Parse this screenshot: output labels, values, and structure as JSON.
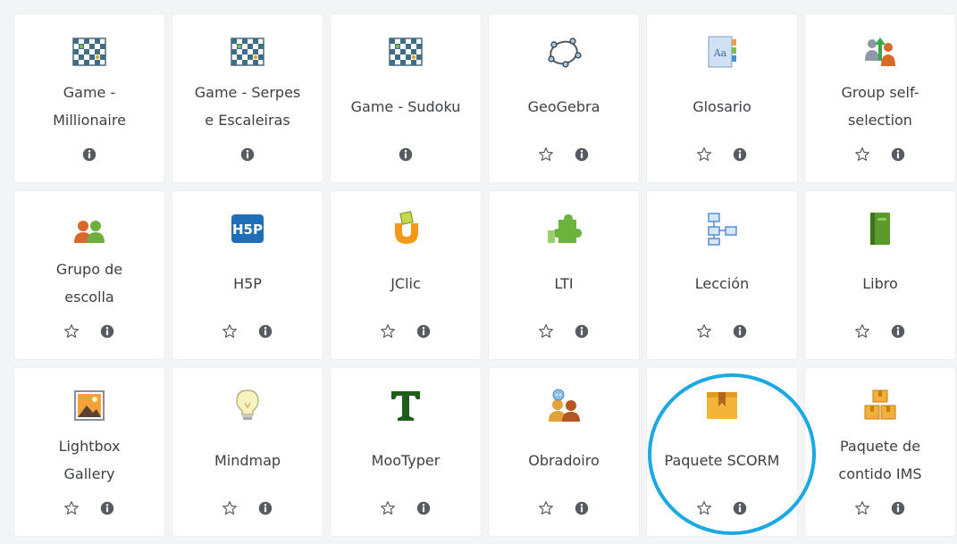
{
  "activities": [
    {
      "label": "Game -\nMillionaire",
      "icon": "checkerboard-game-icon",
      "starred": false
    },
    {
      "label": "Game - Serpes\ne Escaleiras",
      "icon": "checkerboard-game-icon",
      "starred": false
    },
    {
      "label": "Game - Sudoku",
      "icon": "checkerboard-game-icon",
      "starred": false
    },
    {
      "label": "GeoGebra",
      "icon": "geogebra-icon",
      "starred": false
    },
    {
      "label": "Glosario",
      "icon": "glossary-icon",
      "starred": false
    },
    {
      "label": "Group self-\nselection",
      "icon": "group-selection-icon",
      "starred": false
    },
    {
      "label": "Grupo de\nescolla",
      "icon": "choice-group-icon",
      "starred": false
    },
    {
      "label": "H5P",
      "icon": "h5p-icon",
      "starred": false
    },
    {
      "label": "JClic",
      "icon": "jclic-icon",
      "starred": false
    },
    {
      "label": "LTI",
      "icon": "puzzle-piece-icon",
      "starred": false
    },
    {
      "label": "Lección",
      "icon": "lesson-flowchart-icon",
      "starred": false
    },
    {
      "label": "Libro",
      "icon": "book-icon",
      "starred": false
    },
    {
      "label": "Lightbox\nGallery",
      "icon": "image-gallery-icon",
      "starred": false
    },
    {
      "label": "Mindmap",
      "icon": "lightbulb-icon",
      "starred": false
    },
    {
      "label": "MooTyper",
      "icon": "typing-t-icon",
      "starred": false
    },
    {
      "label": "Obradoiro",
      "icon": "workshop-people-icon",
      "starred": false
    },
    {
      "label": "Paquete SCORM",
      "icon": "scorm-package-icon",
      "starred": false
    },
    {
      "label": "Paquete de\ncontido IMS",
      "icon": "ims-package-icon",
      "starred": false
    }
  ],
  "colors": {
    "highlight": "#1aa9e3",
    "text": "#3b3f44",
    "icon_gray": "#555b61"
  }
}
